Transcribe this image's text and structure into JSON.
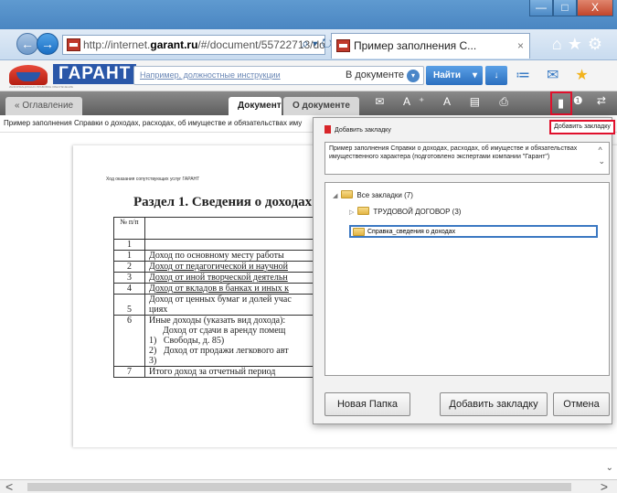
{
  "browser": {
    "url_prefix": "http://internet.",
    "url_domain": "garant.ru",
    "url_rest": "/#/document/55722713/doc",
    "tab_title": "Пример заполнения С...",
    "tab_close": "×",
    "nav_tools": "⌕ ▾ ↻",
    "right_tools": "⌂★⚙",
    "window_buttons": [
      "—",
      "□",
      "X"
    ],
    "back": "←",
    "forward": "→"
  },
  "garant": {
    "logo_text": "ГАРАНТ",
    "logo_tagline": "ИНФОРМАЦИОННО-ПРАВОВОЕ ОБЕСПЕЧЕНИЕ",
    "search_placeholder": "Например, должностные инструкции",
    "search_scope": "В документе",
    "scope_arrow": "▾",
    "find_label": "Найти",
    "small_btn": "↓"
  },
  "doctabs": {
    "toc": "« Оглавление",
    "document": "Документ",
    "about": "О документе",
    "tool_icons": "✉ A⁺ A  ▤ ⎙",
    "bookmark_icon": "▮",
    "right_icons": "❶ ⇄"
  },
  "document": {
    "path": "Пример заполнения Справки о доходах, расходах, об имуществе и обязательствах иму",
    "note": "Ход оказания сопутствующих услуг ГАРАНТ",
    "section_title": "Раздел 1. Сведения о доходах",
    "section_sup": "1",
    "table": {
      "header_num": "№ п/п",
      "header_type": "Вид дох",
      "index_row": [
        "1",
        "2"
      ],
      "rows": [
        {
          "n": "1",
          "text": "Доход по основному месту работы",
          "underline": false
        },
        {
          "n": "2",
          "text": "Доход от педагогической и научной",
          "underline": true
        },
        {
          "n": "3",
          "text": "Доход от иной творческой деятельн",
          "underline": true
        },
        {
          "n": "4",
          "text": "Доход от вкладов в банках и иных к",
          "underline": true
        },
        {
          "n": "5",
          "text": "Доход от ценных бумаг и долей учас\nциях",
          "underline": false
        },
        {
          "n": "6",
          "text": "Иные доходы (указать вид дохода):\n      Доход от сдачи в аренду помещ\n1)   Свободы, д. 85)\n2)   Доход от продажи легкового авт\n3)",
          "underline": false
        },
        {
          "n": "7",
          "text": "Итого доход за отчетный период",
          "underline": false
        }
      ]
    }
  },
  "dialog": {
    "header": "Добавить закладку",
    "tooltip": "Добавить закладку",
    "doc_title": "Пример заполнения Справки о доходах, расходах, об имуществе и обязательствах имущественного характера (подготовлено экспертами компании \"Гарант\")",
    "title_arrows": "^\n⌄",
    "tree": {
      "root_arrow": "◢",
      "root": "Все закладки (7)",
      "child_arrow": "▷",
      "child": "ТРУДОВОЙ ДОГОВОР (3)",
      "new_folder_value": "Справка_сведения о доходах"
    },
    "btn_new_folder": "Новая Папка",
    "btn_add": "Добавить закладку",
    "btn_cancel": "Отмена"
  },
  "scroll": {
    "left": "<",
    "right": ">",
    "down": "⌄"
  }
}
